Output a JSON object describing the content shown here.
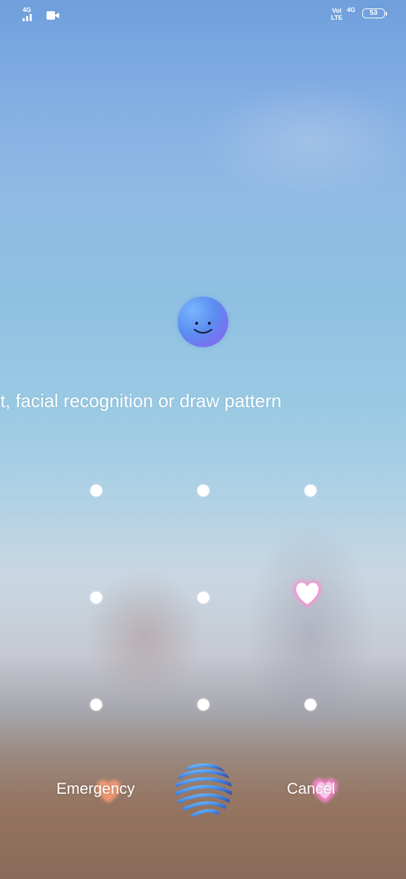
{
  "status_bar": {
    "network_left": "4G",
    "volte_top": "Vol",
    "volte_bottom": "LTE",
    "network_right": "4G",
    "battery": "53",
    "icons": [
      "signal-icon",
      "video-camera-icon",
      "volte-icon",
      "battery-icon"
    ]
  },
  "lock_screen": {
    "face_icon": "smiley-face-icon",
    "hint_text": "nt, facial recognition or draw pattern",
    "pattern_rows": 3,
    "pattern_cols": 3,
    "emergency_label": "Emergency",
    "cancel_label": "Cancel",
    "center_icon": "fingerprint-globe-icon"
  },
  "colors": {
    "text": "#ffffff",
    "face_gradient_start": "#7ab4ff",
    "face_gradient_end": "#b46ae8",
    "heart_pink": "#ff9ad8",
    "heart_peach": "#ffa985"
  }
}
